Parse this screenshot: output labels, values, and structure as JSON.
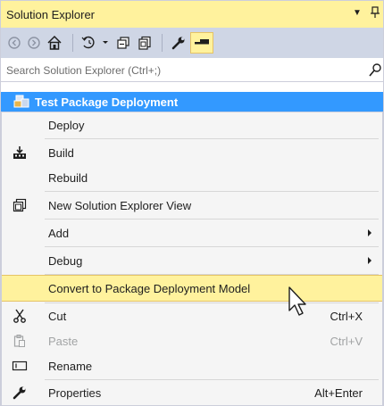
{
  "window": {
    "title": "Solution Explorer",
    "dropdown_icon": "dropdown-arrow-icon",
    "pin_icon": "pin-icon"
  },
  "toolbar": {
    "buttons": [
      {
        "name": "back",
        "icon": "back-arrow-icon"
      },
      {
        "name": "forward",
        "icon": "forward-arrow-icon"
      },
      {
        "name": "home",
        "icon": "home-icon"
      },
      {
        "name": "pending-changes",
        "icon": "history-icon"
      },
      {
        "name": "collapse-all",
        "icon": "collapse-all-icon"
      },
      {
        "name": "show-all-files",
        "icon": "show-all-files-icon"
      },
      {
        "name": "properties",
        "icon": "wrench-icon"
      },
      {
        "name": "preview-selected",
        "icon": "preview-selected-icon"
      }
    ]
  },
  "search": {
    "placeholder": "Search Solution Explorer (Ctrl+;)"
  },
  "tree": {
    "selected_node": "Test Package Deployment"
  },
  "menu": {
    "items": [
      {
        "label": "Deploy",
        "shortcut": "",
        "icon": ""
      },
      {
        "label": "Build",
        "shortcut": "",
        "icon": "build-icon"
      },
      {
        "label": "Rebuild",
        "shortcut": "",
        "icon": ""
      },
      {
        "label": "New Solution Explorer View",
        "shortcut": "",
        "icon": "new-view-icon"
      },
      {
        "label": "Add",
        "shortcut": "",
        "icon": "",
        "submenu": true
      },
      {
        "label": "Debug",
        "shortcut": "",
        "icon": "",
        "submenu": true
      },
      {
        "label": "Convert to Package Deployment Model",
        "shortcut": "",
        "icon": "",
        "highlighted": true
      },
      {
        "label": "Cut",
        "shortcut": "Ctrl+X",
        "icon": "scissors-icon"
      },
      {
        "label": "Paste",
        "shortcut": "Ctrl+V",
        "icon": "paste-icon",
        "disabled": true
      },
      {
        "label": "Rename",
        "shortcut": "",
        "icon": "rename-icon"
      },
      {
        "label": "Properties",
        "shortcut": "Alt+Enter",
        "icon": "wrench-icon"
      }
    ]
  },
  "colors": {
    "title_bar": "#fff29d",
    "toolbar": "#cfd6e5",
    "selection": "#3399ff",
    "menu_background": "#f5f5f5",
    "highlight": "#fff29d"
  }
}
